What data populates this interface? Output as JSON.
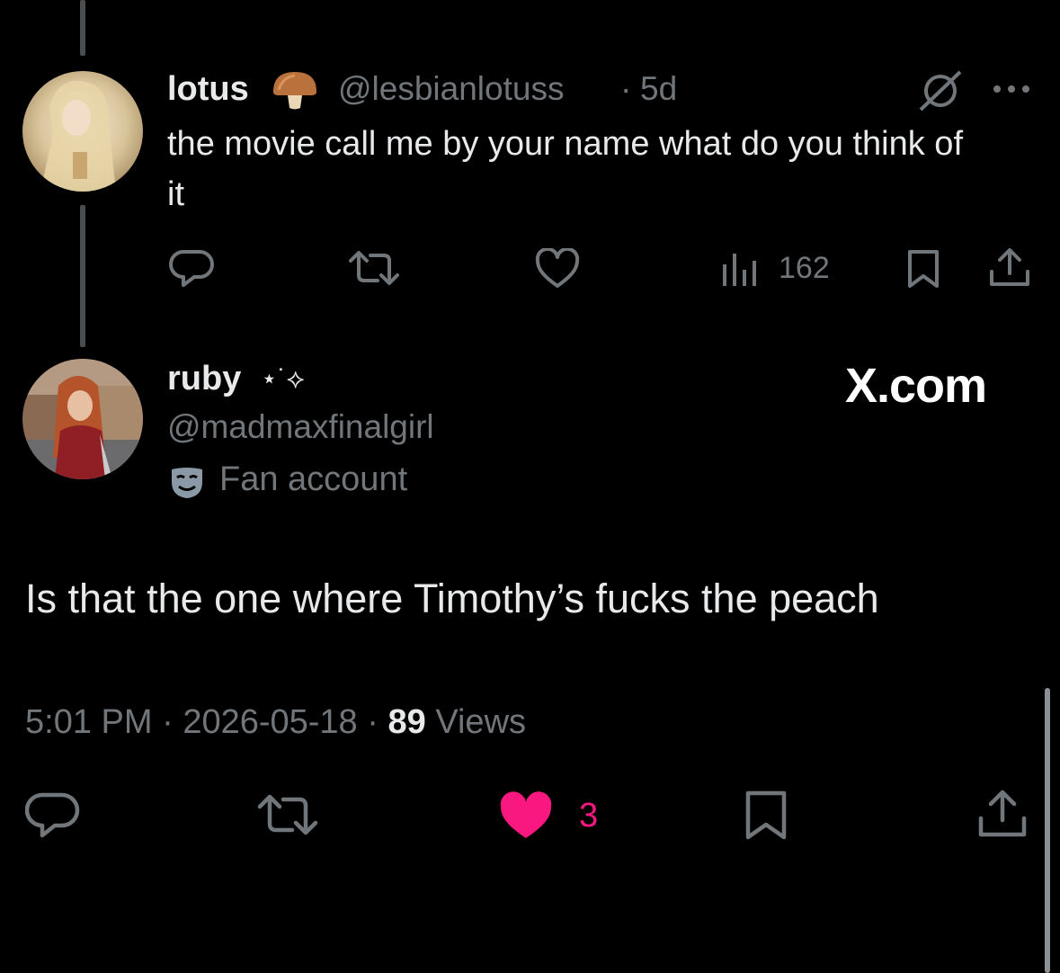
{
  "parent_tweet": {
    "display_name": "lotus",
    "name_emoji": "mushroom-emoji",
    "handle": "@lesbianlotuss",
    "separator": "·",
    "age": "5d",
    "text": "the movie call me by your name what do you think of it",
    "views_count": "162",
    "icons": [
      "grok-icon",
      "more-icon",
      "reply-icon",
      "retweet-icon",
      "like-icon",
      "views-icon",
      "bookmark-icon",
      "share-icon"
    ]
  },
  "reply_tweet": {
    "display_name": "ruby",
    "name_decoration": "⋆˙⟡",
    "handle": "@madmaxfinalgirl",
    "label_text": "Fan account",
    "label_icon": "theater-mask-icon",
    "text": "Is that the one where Timothy’s fucks the peach",
    "time": "5:01 PM",
    "date": "2026-05-18",
    "separator": "·",
    "views_count": "89",
    "views_label": "Views",
    "like_count": "3",
    "liked": true
  },
  "watermark": "X.com",
  "colors": {
    "background": "#000000",
    "text_primary": "#e7e9ea",
    "text_secondary": "#71767b",
    "like_active": "#f91880",
    "thread_line": "#4a4d50"
  }
}
